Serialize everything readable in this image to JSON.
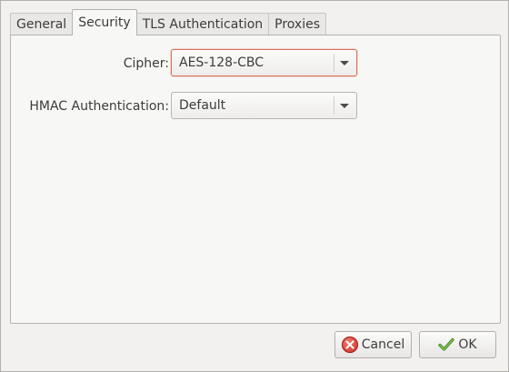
{
  "tabs": [
    {
      "label": "General"
    },
    {
      "label": "Security"
    },
    {
      "label": "TLS Authentication"
    },
    {
      "label": "Proxies"
    }
  ],
  "active_tab": "Security",
  "form": {
    "cipher": {
      "label": "Cipher:",
      "value": "AES-128-CBC"
    },
    "hmac": {
      "label": "HMAC Authentication:",
      "value": "Default"
    }
  },
  "buttons": {
    "cancel": {
      "label": "Cancel",
      "icon": "cancel-icon"
    },
    "ok": {
      "label": "OK",
      "icon": "checkmark-icon"
    }
  },
  "colors": {
    "focus_border": "#d8735d",
    "cancel_icon": "#c62a20",
    "ok_icon": "#5aa02c"
  }
}
